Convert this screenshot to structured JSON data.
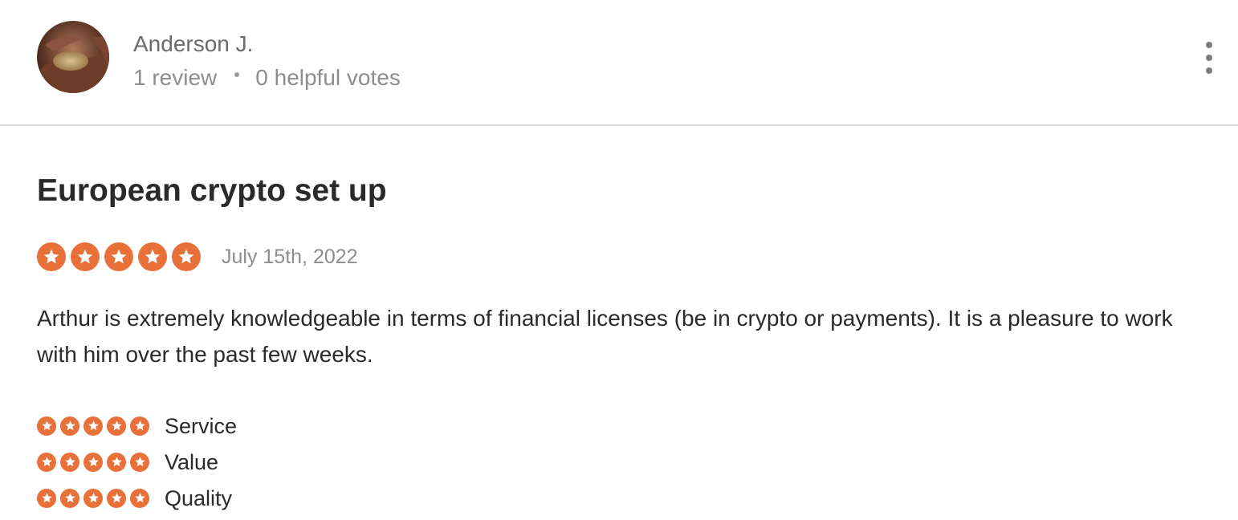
{
  "reviewer": {
    "name": "Anderson J.",
    "review_count": "1 review",
    "helpful_votes": "0 helpful votes"
  },
  "review": {
    "title": "European crypto set up",
    "rating": 5,
    "date": "July 15th, 2022",
    "body": "Arthur is extremely knowledgeable in terms of financial licenses (be in crypto or payments). It is a pleasure to work with him over the past few weeks."
  },
  "sub_ratings": [
    {
      "label": "Service",
      "rating": 5
    },
    {
      "label": "Value",
      "rating": 5
    },
    {
      "label": "Quality",
      "rating": 5
    }
  ],
  "icons": {
    "star": "star-icon",
    "more": "more-vertical-icon",
    "avatar": "reviewer-avatar-photo"
  },
  "colors": {
    "star": "#e8713a",
    "divider": "#dcdcdc",
    "text_primary": "#2a2a2a",
    "text_muted": "#8e8e8e"
  }
}
